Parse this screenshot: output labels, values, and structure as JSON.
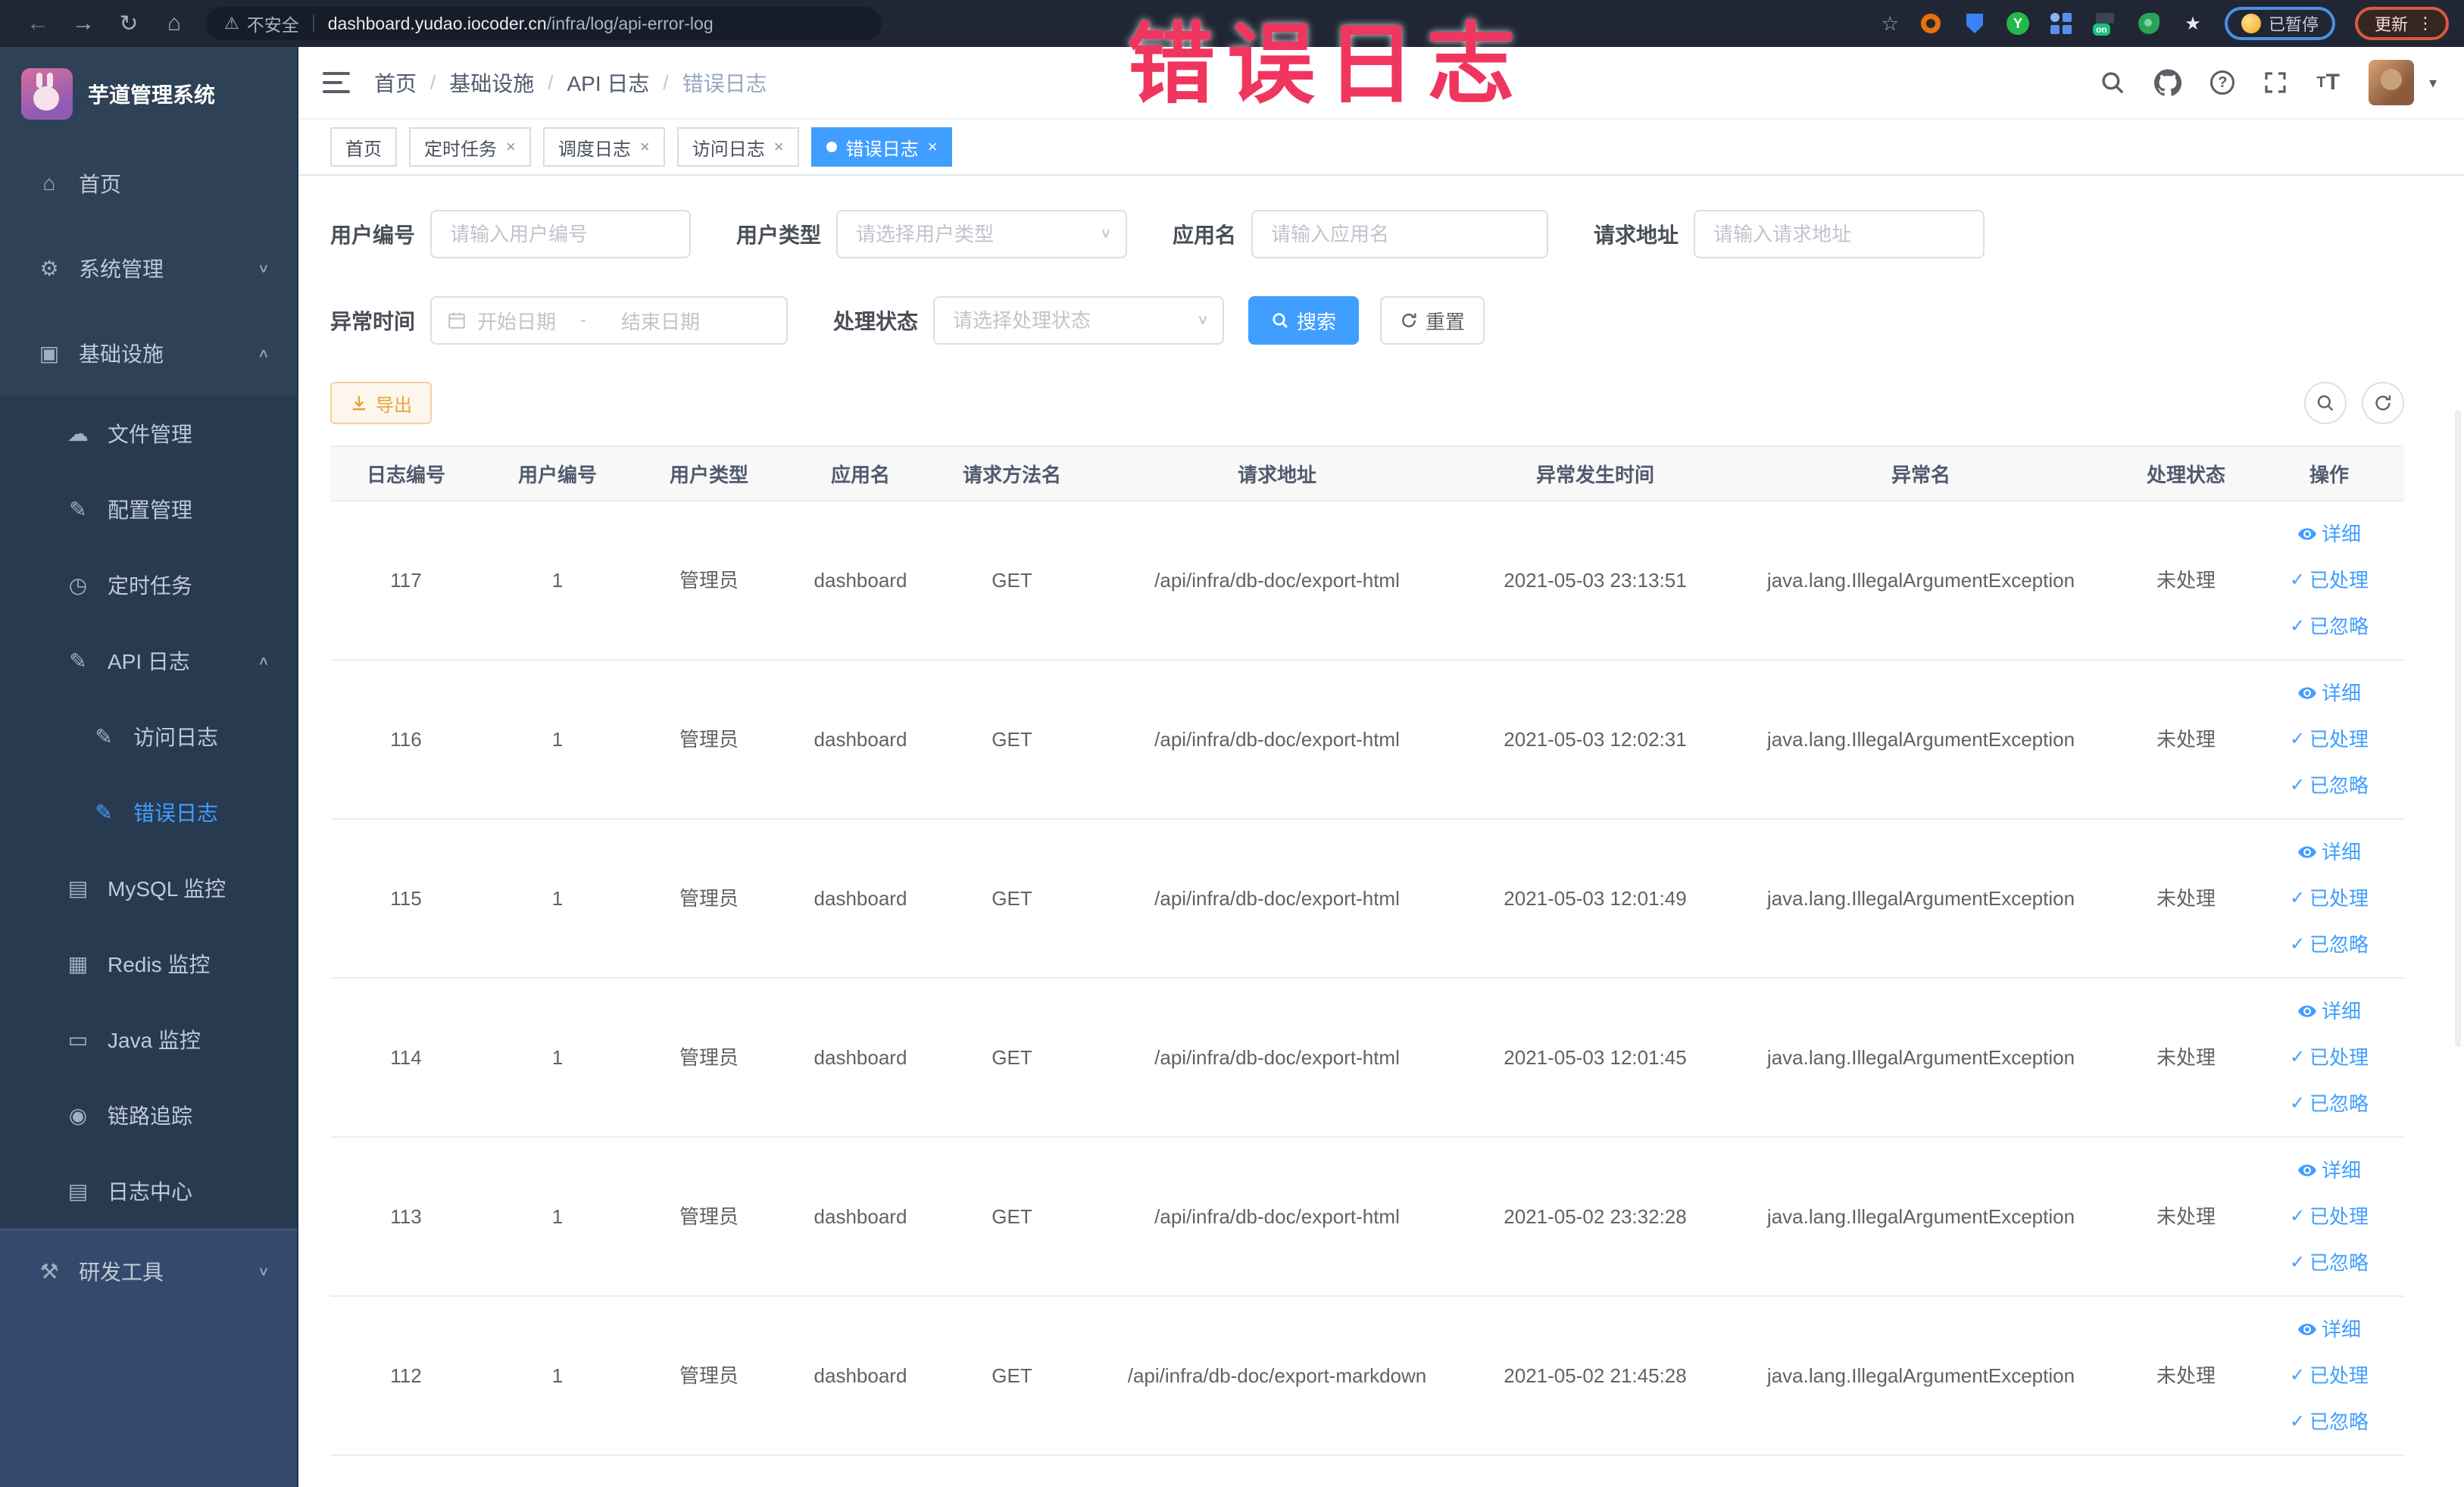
{
  "watermark": "错误日志",
  "browser": {
    "security_label": "不安全",
    "url_host": "dashboard.yudao.iocoder.cn",
    "url_path": "/infra/log/api-error-log",
    "extension_on_badge": "on",
    "paused_badge": "已暂停",
    "update_button": "更新"
  },
  "sidebar": {
    "title": "芋道管理系统",
    "items": [
      {
        "label": "首页",
        "icon": "home-icon",
        "level": 0
      },
      {
        "label": "系统管理",
        "icon": "gear-icon",
        "level": 0,
        "chevron": "down"
      },
      {
        "label": "基础设施",
        "icon": "infra-icon",
        "level": 0,
        "chevron": "up"
      },
      {
        "label": "文件管理",
        "icon": "file-icon",
        "level": 1
      },
      {
        "label": "配置管理",
        "icon": "config-icon",
        "level": 1
      },
      {
        "label": "定时任务",
        "icon": "job-icon",
        "level": 1
      },
      {
        "label": "API 日志",
        "icon": "apilog-icon",
        "level": 1,
        "chevron": "up"
      },
      {
        "label": "访问日志",
        "icon": "accesslog-icon",
        "level": 2
      },
      {
        "label": "错误日志",
        "icon": "errorlog-icon",
        "level": 2,
        "active": true
      },
      {
        "label": "MySQL 监控",
        "icon": "mysql-icon",
        "level": 1
      },
      {
        "label": "Redis 监控",
        "icon": "redis-icon",
        "level": 1
      },
      {
        "label": "Java 监控",
        "icon": "java-icon",
        "level": 1
      },
      {
        "label": "链路追踪",
        "icon": "trace-icon",
        "level": 1
      },
      {
        "label": "日志中心",
        "icon": "logcenter-icon",
        "level": 1
      },
      {
        "label": "研发工具",
        "icon": "devtools-icon",
        "level": 0,
        "chevron": "down",
        "section": "tools"
      }
    ]
  },
  "header": {
    "breadcrumb": [
      "首页",
      "基础设施",
      "API 日志",
      "错误日志"
    ]
  },
  "tabs": [
    {
      "label": "首页",
      "closable": false,
      "active": false
    },
    {
      "label": "定时任务",
      "closable": true,
      "active": false
    },
    {
      "label": "调度日志",
      "closable": true,
      "active": false
    },
    {
      "label": "访问日志",
      "closable": true,
      "active": false
    },
    {
      "label": "错误日志",
      "closable": true,
      "active": true
    }
  ],
  "filters": {
    "user_id_label": "用户编号",
    "user_id_placeholder": "请输入用户编号",
    "user_type_label": "用户类型",
    "user_type_placeholder": "请选择用户类型",
    "app_name_label": "应用名",
    "app_name_placeholder": "请输入应用名",
    "request_url_label": "请求地址",
    "request_url_placeholder": "请输入请求地址",
    "exception_time_label": "异常时间",
    "start_date_placeholder": "开始日期",
    "date_separator": "-",
    "end_date_placeholder": "结束日期",
    "process_status_label": "处理状态",
    "process_status_placeholder": "请选择处理状态",
    "search_button": "搜索",
    "reset_button": "重置"
  },
  "toolbar": {
    "export_button": "导出"
  },
  "table": {
    "columns": [
      "日志编号",
      "用户编号",
      "用户类型",
      "应用名",
      "请求方法名",
      "请求地址",
      "异常发生时间",
      "异常名",
      "处理状态",
      "操作"
    ],
    "actions": {
      "detail": "详细",
      "processed": "已处理",
      "ignored": "已忽略"
    },
    "rows": [
      {
        "id": "117",
        "user_id": "1",
        "user_type": "管理员",
        "app": "dashboard",
        "method": "GET",
        "url": "/api/infra/db-doc/export-html",
        "time": "2021-05-03 23:13:51",
        "exception": "java.lang.IllegalArgumentException",
        "status": "未处理"
      },
      {
        "id": "116",
        "user_id": "1",
        "user_type": "管理员",
        "app": "dashboard",
        "method": "GET",
        "url": "/api/infra/db-doc/export-html",
        "time": "2021-05-03 12:02:31",
        "exception": "java.lang.IllegalArgumentException",
        "status": "未处理"
      },
      {
        "id": "115",
        "user_id": "1",
        "user_type": "管理员",
        "app": "dashboard",
        "method": "GET",
        "url": "/api/infra/db-doc/export-html",
        "time": "2021-05-03 12:01:49",
        "exception": "java.lang.IllegalArgumentException",
        "status": "未处理"
      },
      {
        "id": "114",
        "user_id": "1",
        "user_type": "管理员",
        "app": "dashboard",
        "method": "GET",
        "url": "/api/infra/db-doc/export-html",
        "time": "2021-05-03 12:01:45",
        "exception": "java.lang.IllegalArgumentException",
        "status": "未处理"
      },
      {
        "id": "113",
        "user_id": "1",
        "user_type": "管理员",
        "app": "dashboard",
        "method": "GET",
        "url": "/api/infra/db-doc/export-html",
        "time": "2021-05-02 23:32:28",
        "exception": "java.lang.IllegalArgumentException",
        "status": "未处理"
      },
      {
        "id": "112",
        "user_id": "1",
        "user_type": "管理员",
        "app": "dashboard",
        "method": "GET",
        "url": "/api/infra/db-doc/export-markdown",
        "time": "2021-05-02 21:45:28",
        "exception": "java.lang.IllegalArgumentException",
        "status": "未处理"
      }
    ]
  },
  "colors": {
    "accent": "#409eff",
    "warning": "#e6a23c",
    "watermark": "#f0355f",
    "sidebar_bg": "#2e4156"
  }
}
